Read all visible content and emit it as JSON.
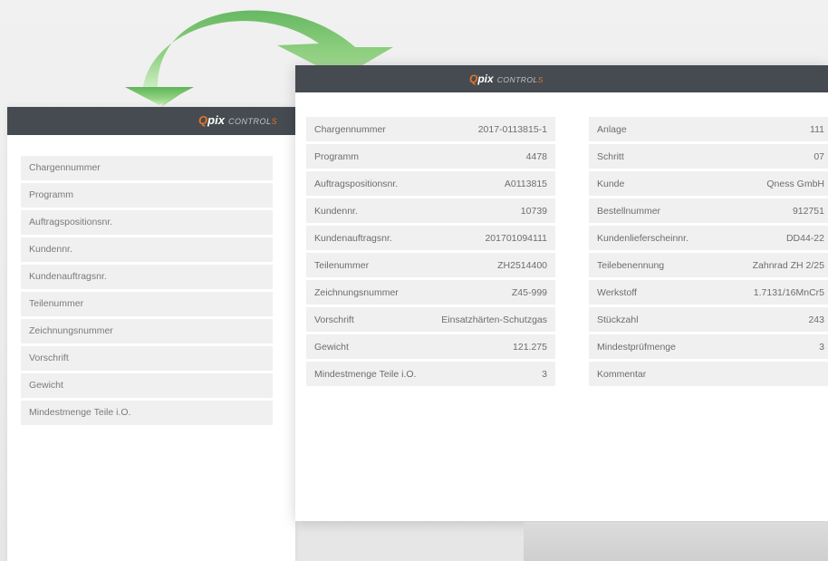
{
  "brand": {
    "q": "Q",
    "pix": "pix",
    "control": "CONTROL",
    "control_s": "S"
  },
  "back_window": {
    "fields": [
      "Chargennummer",
      "Programm",
      "Auftragspositionsnr.",
      "Kundennr.",
      "Kundenauftragsnr.",
      "Teilenummer",
      "Zeichnungsnummer",
      "Vorschrift",
      "Gewicht",
      "Mindestmenge Teile i.O."
    ]
  },
  "front_window": {
    "left_rows": [
      {
        "label": "Chargennummer",
        "value": "2017-0113815-1"
      },
      {
        "label": "Programm",
        "value": "4478"
      },
      {
        "label": "Auftragspositionsnr.",
        "value": "A0113815"
      },
      {
        "label": "Kundennr.",
        "value": "10739"
      },
      {
        "label": "Kundenauftragsnr.",
        "value": "201701094111"
      },
      {
        "label": "Teilenummer",
        "value": "ZH2514400"
      },
      {
        "label": "Zeichnungsnummer",
        "value": "Z45-999"
      },
      {
        "label": "Vorschrift",
        "value": "Einsatzhärten-Schutzgas"
      },
      {
        "label": "Gewicht",
        "value": "121.275"
      },
      {
        "label": "Mindestmenge Teile i.O.",
        "value": "3"
      }
    ],
    "right_rows": [
      {
        "label": "Anlage",
        "value": "111"
      },
      {
        "label": "Schritt",
        "value": "07"
      },
      {
        "label": "Kunde",
        "value": "Qness GmbH"
      },
      {
        "label": "Bestellnummer",
        "value": "912751"
      },
      {
        "label": "Kundenlieferscheinnr.",
        "value": "DD44-22"
      },
      {
        "label": "Teilebenennung",
        "value": "Zahnrad ZH 2/25"
      },
      {
        "label": "Werkstoff",
        "value": "1.7131/16MnCr5"
      },
      {
        "label": "Stückzahl",
        "value": "243"
      },
      {
        "label": "Mindestprüfmenge",
        "value": "3"
      },
      {
        "label": "Kommentar",
        "value": ""
      }
    ]
  },
  "colors": {
    "header": "#454b50",
    "brand_orange": "#e8732b",
    "arrow_green": "#7cc76a",
    "row_bg": "#f0f0f0"
  }
}
